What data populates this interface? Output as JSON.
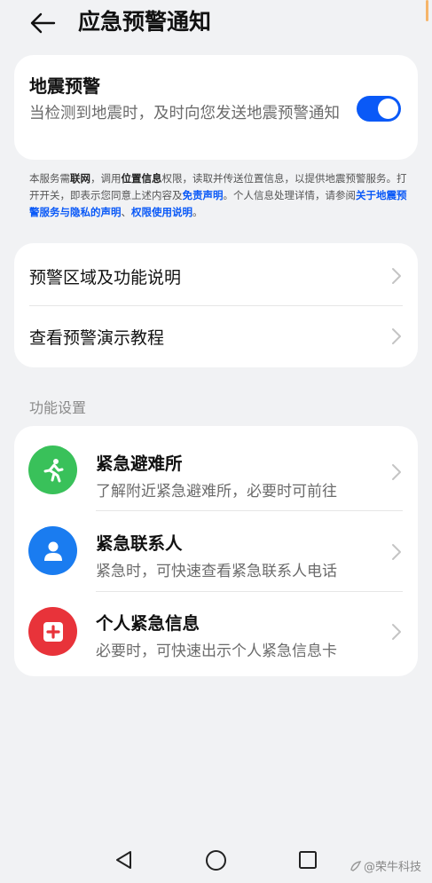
{
  "header": {
    "title": "应急预警通知"
  },
  "earthquake": {
    "title": "地震预警",
    "desc": "当检测到地震时，及时向您发送地震预警通知",
    "toggle_on": true
  },
  "notice": {
    "p1": "本服务需",
    "b1": "联网",
    "p2": "，调用",
    "b2": "位置信息",
    "p3": "权限，读取并传送位置信息，以提供地震预警服务。打开开关，即表示您同意上述内容及",
    "l1": "免责声明",
    "p4": "。个人信息处理详情，请参阅",
    "l2": "关于地震预警服务与隐私的声明",
    "p5": "、",
    "l3": "权限使用说明",
    "p6": "。"
  },
  "info_rows": [
    {
      "label": "预警区域及功能说明"
    },
    {
      "label": "查看预警演示教程"
    }
  ],
  "section": {
    "label": "功能设置"
  },
  "features": [
    {
      "title": "紧急避难所",
      "desc": "了解附近紧急避难所，必要时可前往",
      "icon": "running-person-icon",
      "color": "#39c15a"
    },
    {
      "title": "紧急联系人",
      "desc": "紧急时，可快速查看紧急联系人电话",
      "icon": "contact-person-icon",
      "color": "#1a7cf0"
    },
    {
      "title": "个人紧急信息",
      "desc": "必要时，可快速出示个人紧急信息卡",
      "icon": "medical-cross-icon",
      "color": "#e8333a"
    }
  ],
  "navbar": {
    "back": "back-triangle-icon",
    "home": "home-circle-icon",
    "recents": "recents-square-icon"
  },
  "watermark": {
    "text": "@荣牛科技"
  },
  "colors": {
    "accent": "#0a59f7",
    "background": "#f1f2f4",
    "card": "#ffffff"
  }
}
